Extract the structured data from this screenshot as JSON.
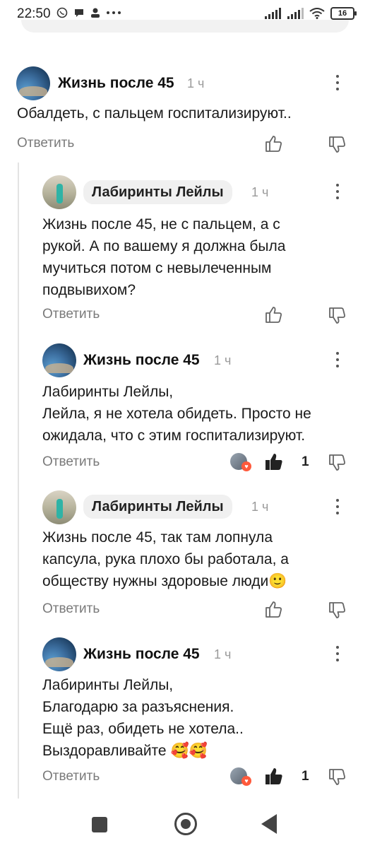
{
  "status_bar": {
    "time": "22:50",
    "battery": "16"
  },
  "comments": [
    {
      "author": "Жизнь после 45",
      "time": "1 ч",
      "text": "Обалдеть, с пальцем госпитализируют..",
      "reply_label": "Ответить",
      "likes": ""
    },
    {
      "author": "Лабиринты Лейлы",
      "time": "1 ч",
      "text": "Жизнь после 45, не с пальцем, а с\nрукой. А по вашему я должна была\nмучиться потом с невылеченным\nподвывихом?",
      "reply_label": "Ответить",
      "likes": ""
    },
    {
      "author": "Жизнь после 45",
      "time": "1 ч",
      "text": "Лабиринты Лейлы,\nЛейла, я не хотела обидеть. Просто не\nожидала, что с этим госпитализируют.",
      "reply_label": "Ответить",
      "likes": "1"
    },
    {
      "author": "Лабиринты Лейлы",
      "time": "1 ч",
      "text": "Жизнь после 45, так там лопнула\nкапсула, рука плохо бы работала, а\nобществу нужны здоровые люди🙂",
      "reply_label": "Ответить",
      "likes": ""
    },
    {
      "author": "Жизнь после 45",
      "time": "1 ч",
      "text": "Лабиринты Лейлы,\nБлагодарю за разъяснения.\nЕщё раз, обидеть не хотела..\nВыздоравливайте 🥰🥰",
      "reply_label": "Ответить",
      "likes": "1"
    }
  ],
  "icons": {
    "like": "thumb-up-icon",
    "dislike": "thumb-down-icon",
    "more": "more-vertical-icon"
  }
}
